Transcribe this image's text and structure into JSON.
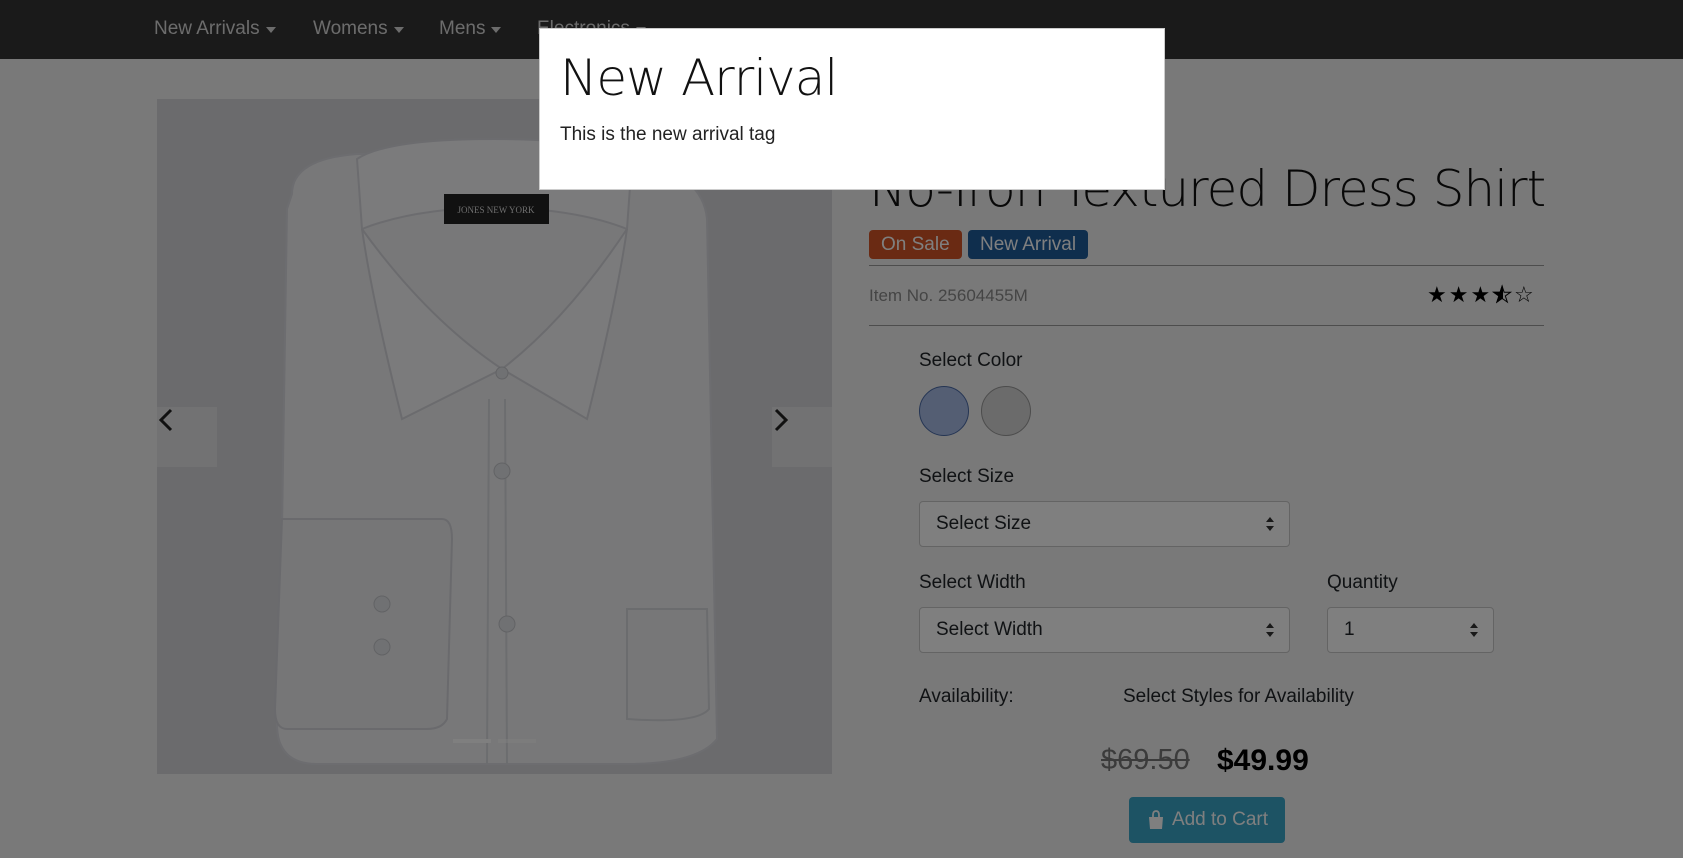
{
  "nav": {
    "items": [
      {
        "label": "New Arrivals"
      },
      {
        "label": "Womens"
      },
      {
        "label": "Mens"
      },
      {
        "label": "Electronics"
      }
    ]
  },
  "carousel": {
    "tag_text": "JONES NEW YORK",
    "prev_icon": "chevron-left-icon",
    "next_icon": "chevron-right-icon",
    "indicator_count": 2,
    "active_index": 0
  },
  "product": {
    "title": "No-Iron Textured Dress Shirt",
    "badges": [
      {
        "label": "On Sale",
        "color": "#d45427"
      },
      {
        "label": "New Arrival",
        "color": "#1f5c9b"
      }
    ],
    "item_no": "Item No. 25604455M",
    "rating": 3.5,
    "rating_max": 5,
    "select_color_label": "Select Color",
    "colors": [
      "#a9bde6",
      "#d6d6d6"
    ],
    "select_size_label": "Select Size",
    "size_value": "Select Size",
    "select_width_label": "Select Width",
    "width_value": "Select Width",
    "quantity_label": "Quantity",
    "quantity_value": "1",
    "availability_label": "Availability:",
    "availability_value": "Select Styles for Availability",
    "price_old": "$69.50",
    "price_new": "$49.99",
    "cart_label": "Add to Cart"
  },
  "modal": {
    "title": "New Arrival",
    "body": "This is the new arrival tag"
  }
}
